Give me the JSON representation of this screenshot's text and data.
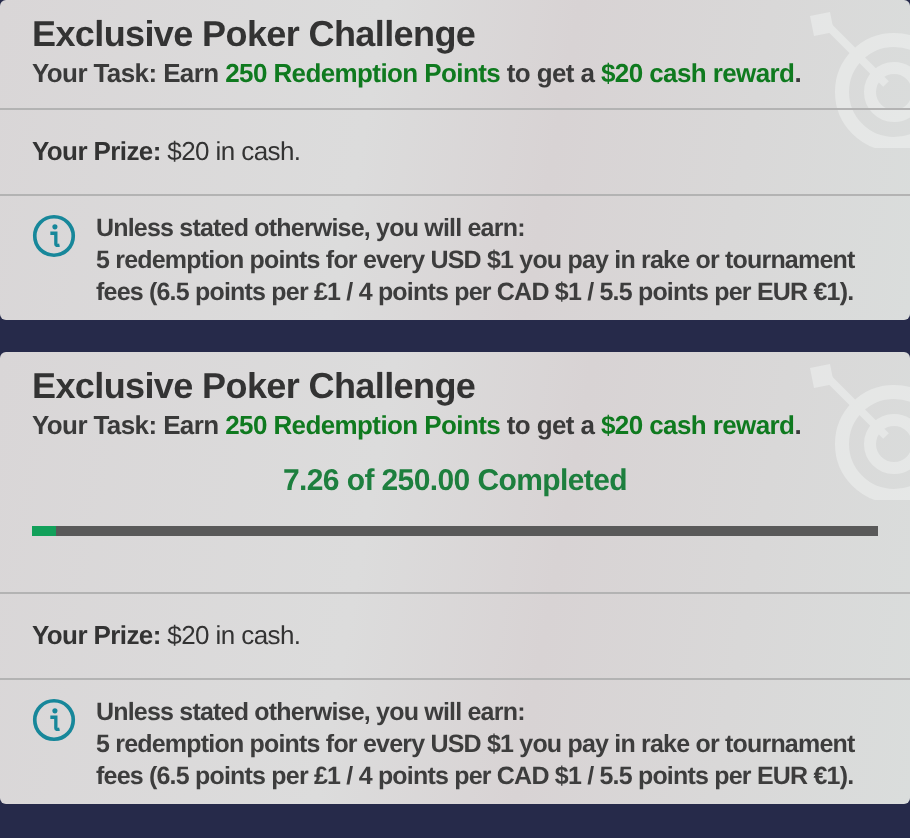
{
  "cards": [
    {
      "title": "Exclusive Poker Challenge",
      "task": [
        {
          "text": "Your Task: Earn ",
          "highlight": false
        },
        {
          "text": "250 Redemption Points",
          "highlight": true
        },
        {
          "text": " to get a ",
          "highlight": false
        },
        {
          "text": "$20 cash reward",
          "highlight": true
        },
        {
          "text": ".",
          "highlight": false
        }
      ],
      "prize": "**Your Prize:** $20 in cash.",
      "info_heading": "Unless stated otherwise, you will earn:",
      "info_text": "5 redemption points for every USD $1 you pay in rake or tournament fees (6.5 points per £1 / 4 points per CAD $1 / 5.5 points per EUR €1)."
    },
    {
      "title": "Exclusive Poker Challenge",
      "task": [
        {
          "text": "Your Task: Earn ",
          "highlight": false
        },
        {
          "text": "250 Redemption Points",
          "highlight": true
        },
        {
          "text": " to get a ",
          "highlight": false
        },
        {
          "text": "$20 cash reward",
          "highlight": true
        },
        {
          "text": ".",
          "highlight": false
        }
      ],
      "progress": {
        "label": "7.26 of 250.00 Completed",
        "level": 0.029
      },
      "prize": "**Your Prize:** $20 in cash.",
      "info_heading": "Unless stated otherwise, you will earn:",
      "info_text": "5 redemption points for every USD $1 you pay in rake or tournament fees (6.5 points per £1 / 4 points per CAD $1 / 5.5 points per EUR €1)."
    }
  ]
}
